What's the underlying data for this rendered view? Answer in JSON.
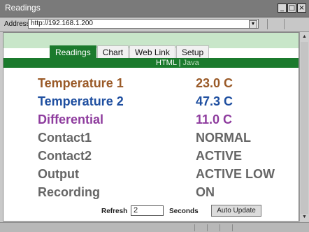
{
  "window": {
    "title": "Readings",
    "controls": [
      "_",
      "□",
      "×"
    ]
  },
  "address_bar": {
    "label": "Address",
    "url": "http://192.168.1.200"
  },
  "tabs": [
    "Readings",
    "Chart",
    "Web Link",
    "Setup"
  ],
  "active_tab": "Readings",
  "subnav": {
    "html": "HTML",
    "separator": "|",
    "java": "Java"
  },
  "readings": [
    {
      "label": "Temperature 1",
      "value": "23.0 C",
      "color": "#9a5a28"
    },
    {
      "label": "Temperature 2",
      "value": "47.3 C",
      "color": "#1f4fa0"
    },
    {
      "label": "Differential",
      "value": "11.0 C",
      "color": "#8e3c9e"
    },
    {
      "label": "Contact1",
      "value": "NORMAL",
      "color": "#666666"
    },
    {
      "label": "Contact2",
      "value": "ACTIVE",
      "color": "#666666"
    },
    {
      "label": "Output",
      "value": "ACTIVE LOW",
      "color": "#666666"
    },
    {
      "label": "Recording",
      "value": "ON",
      "color": "#666666"
    }
  ],
  "refresh": {
    "label": "Refresh",
    "value": "2",
    "unit": "Seconds",
    "button": "Auto Update"
  },
  "theme": {
    "accent_green": "#1b7a2d",
    "band_green": "#c8e6c9"
  }
}
